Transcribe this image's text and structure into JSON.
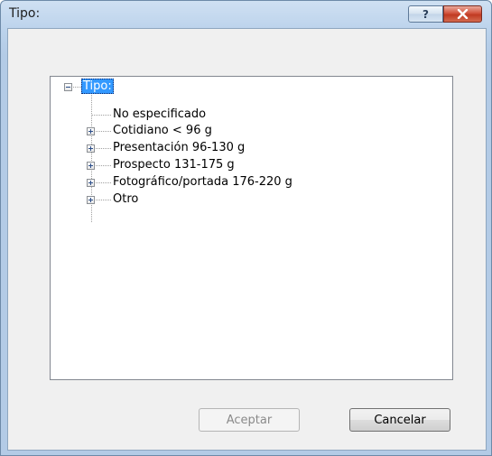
{
  "window": {
    "title": "Tipo:",
    "help_label": "?"
  },
  "tree": {
    "root": {
      "label": "Tipo:",
      "expanded": true,
      "selected": true
    },
    "children": [
      {
        "label": "No especificado",
        "expandable": false
      },
      {
        "label": "Cotidiano < 96 g",
        "expandable": true
      },
      {
        "label": "Presentación 96-130 g",
        "expandable": true
      },
      {
        "label": "Prospecto 131-175 g",
        "expandable": true
      },
      {
        "label": "Fotográfico/portada 176-220 g",
        "expandable": true
      },
      {
        "label": "Otro",
        "expandable": true
      }
    ]
  },
  "buttons": {
    "ok_label": "Aceptar",
    "cancel_label": "Cancelar"
  },
  "colors": {
    "selection": "#3399ff",
    "close_button": "#c03a22",
    "dialog_background": "#f0f0f0"
  }
}
